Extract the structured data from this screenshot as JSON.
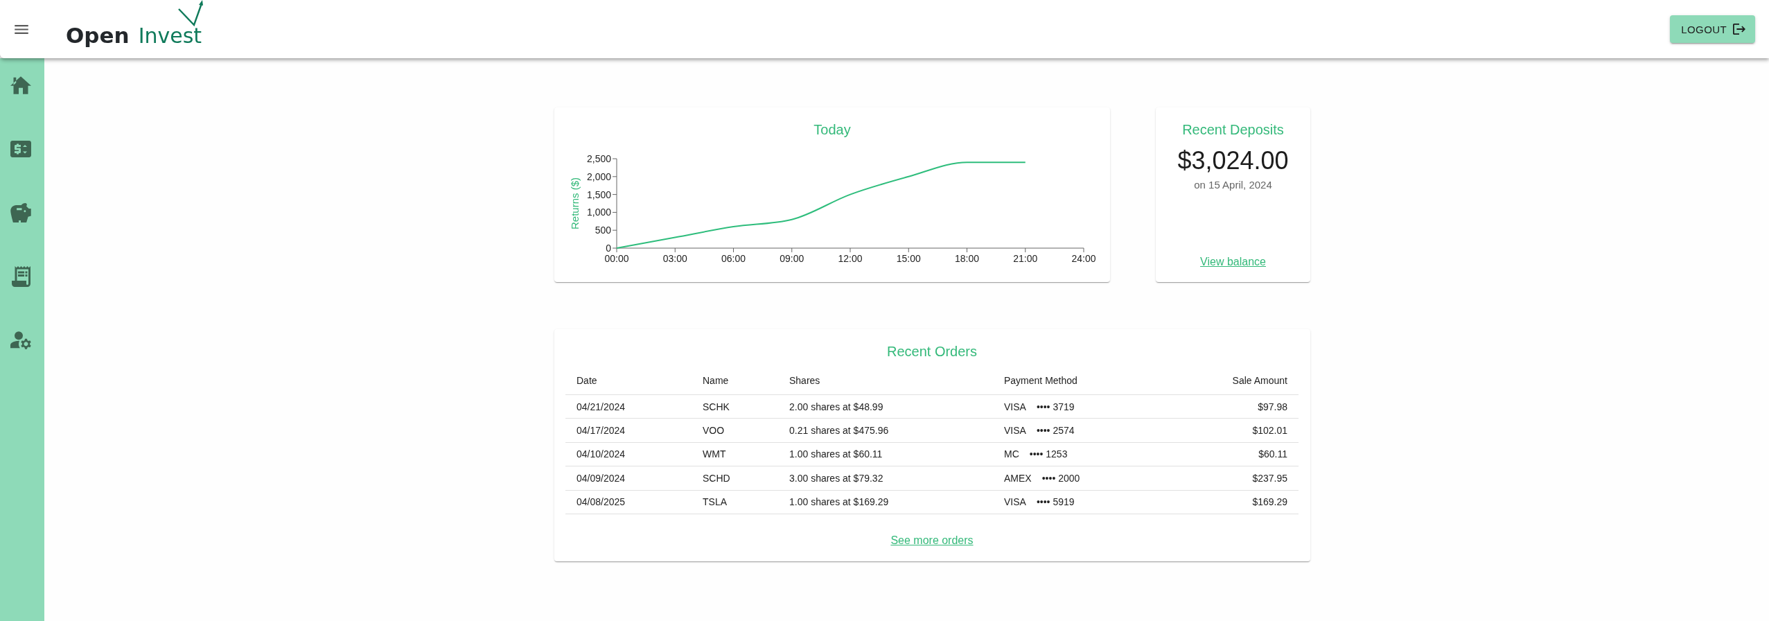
{
  "header": {
    "logo": {
      "primary": "Open",
      "secondary": "Invest"
    },
    "logout_button": "LOGOUT"
  },
  "sidebar": {
    "items": [
      {
        "kind": "home"
      },
      {
        "kind": "price"
      },
      {
        "kind": "savings"
      },
      {
        "kind": "receipt"
      },
      {
        "kind": "account"
      }
    ]
  },
  "returns_card": {
    "chart_data": {
      "type": "line",
      "title": "Today",
      "ylabel": "Returns ($)",
      "x": [
        0,
        3,
        6,
        9,
        12,
        15,
        18,
        21
      ],
      "values": [
        0,
        300,
        600,
        800,
        1500,
        2000,
        2400,
        2400
      ],
      "xlim": [
        0,
        24
      ],
      "ylim": [
        0,
        2500
      ],
      "xticks": [
        {
          "value": 0,
          "label": "00:00"
        },
        {
          "value": 3,
          "label": "03:00"
        },
        {
          "value": 6,
          "label": "06:00"
        },
        {
          "value": 9,
          "label": "09:00"
        },
        {
          "value": 12,
          "label": "12:00"
        },
        {
          "value": 15,
          "label": "15:00"
        },
        {
          "value": 18,
          "label": "18:00"
        },
        {
          "value": 21,
          "label": "21:00"
        },
        {
          "value": 24,
          "label": "24:00"
        }
      ],
      "yticks": [
        {
          "value": 0,
          "label": "0"
        },
        {
          "value": 500,
          "label": "500"
        },
        {
          "value": 1000,
          "label": "1,000"
        },
        {
          "value": 1500,
          "label": "1,500"
        },
        {
          "value": 2000,
          "label": "2,000"
        },
        {
          "value": 2500,
          "label": "2,500"
        }
      ]
    }
  },
  "deposits_card": {
    "title": "Recent Deposits",
    "amount": "$3,024.00",
    "date": "on 15 April, 2024",
    "link": "View balance"
  },
  "orders_card": {
    "title": "Recent Orders",
    "columns": [
      "Date",
      "Name",
      "Shares",
      "Payment Method",
      "Sale Amount"
    ],
    "rows": [
      {
        "date": "04/21/2024",
        "name": "SCHK",
        "shares": "2.00 shares at $48.99",
        "card_brand": "VISA",
        "card_number": "•••• 3719",
        "amount": "$97.98"
      },
      {
        "date": "04/17/2024",
        "name": "VOO",
        "shares": "0.21 shares at $475.96",
        "card_brand": "VISA",
        "card_number": "•••• 2574",
        "amount": "$102.01"
      },
      {
        "date": "04/10/2024",
        "name": "WMT",
        "shares": "1.00 shares at $60.11",
        "card_brand": "MC",
        "card_number": "•••• 1253",
        "amount": "$60.11"
      },
      {
        "date": "04/09/2024",
        "name": "SCHD",
        "shares": "3.00 shares at $79.32",
        "card_brand": "AMEX",
        "card_number": "•••• 2000",
        "amount": "$237.95"
      },
      {
        "date": "04/08/2025",
        "name": "TSLA",
        "shares": "1.00 shares at $169.29",
        "card_brand": "VISA",
        "card_number": "•••• 5919",
        "amount": "$169.29"
      }
    ],
    "link": "See more orders"
  }
}
